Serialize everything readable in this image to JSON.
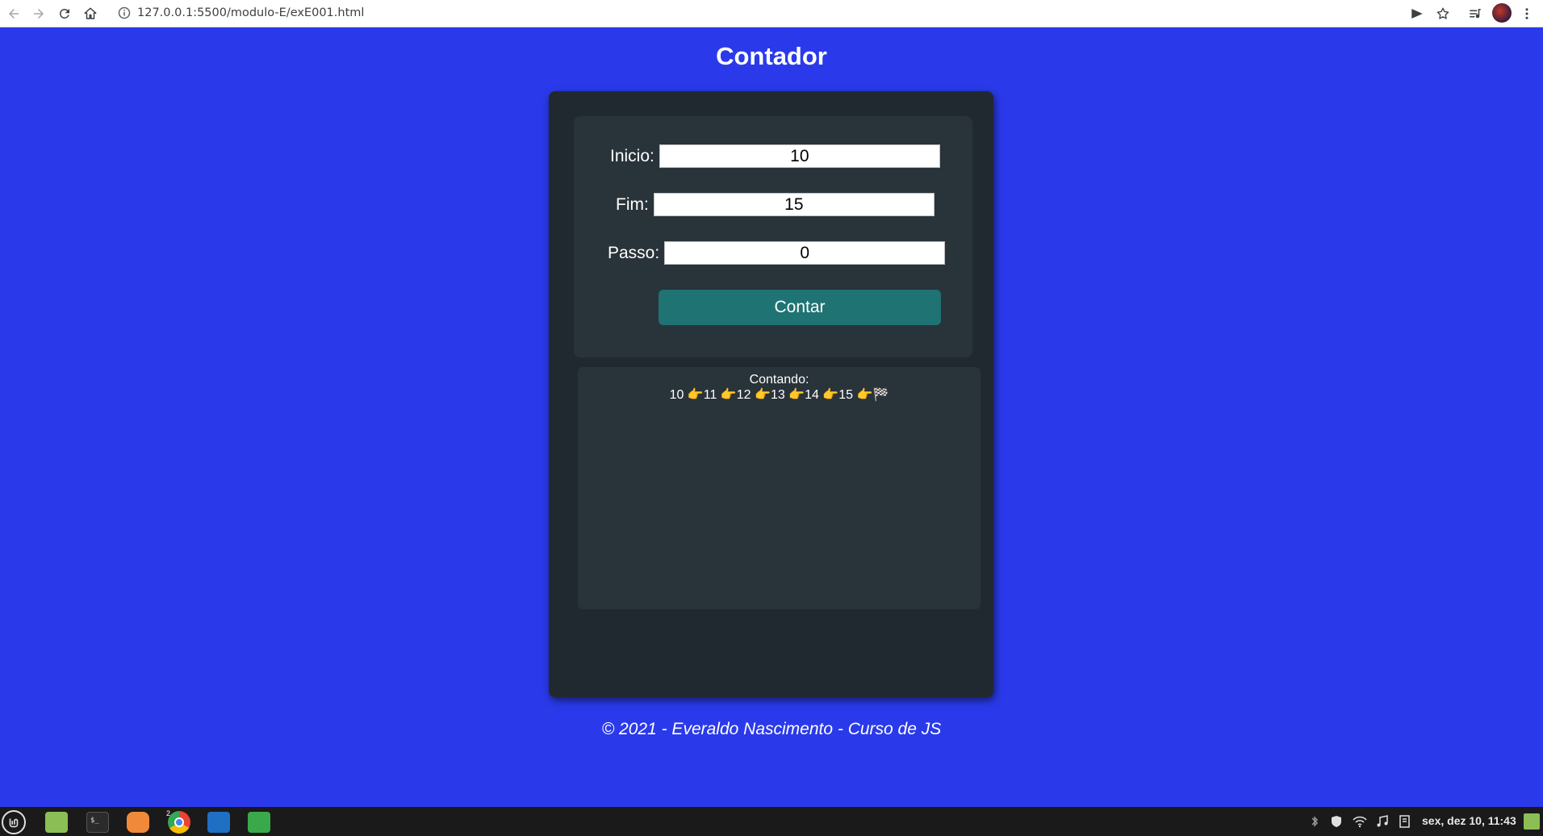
{
  "browser": {
    "url": "127.0.0.1:5500/modulo-E/exE001.html"
  },
  "page": {
    "title": "Contador",
    "footer": "© 2021 - Everaldo Nascimento - Curso de JS"
  },
  "form": {
    "inicio_label": "Inicio:",
    "inicio_value": "10",
    "fim_label": "Fim:",
    "fim_value": "15",
    "passo_label": "Passo:",
    "passo_value": "0",
    "button_label": "Contar"
  },
  "result": {
    "heading": "Contando:",
    "sequence": "10 👉11 👉12 👉13 👉14 👉15 👉🏁"
  },
  "taskbar": {
    "clock": "sex, dez 10, 11:43",
    "chrome_badge": "2"
  },
  "colors": {
    "page_background": "#2a3aea",
    "card_background": "#212930",
    "panel_background": "#29333a",
    "button_background": "#1f7373"
  }
}
